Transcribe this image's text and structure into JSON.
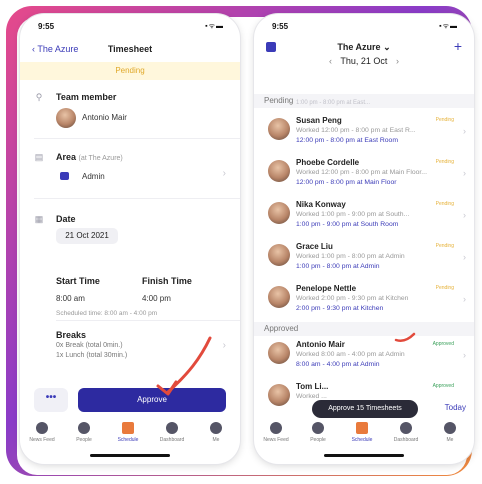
{
  "left": {
    "status_time": "9:55",
    "status_icons": "▪ᯤ▬",
    "back_label": "The Azure",
    "title": "Timesheet",
    "status_banner": "Pending",
    "team_member": {
      "label": "Team member",
      "name": "Antonio Mair"
    },
    "area": {
      "label": "Area",
      "sub": "(at The Azure)",
      "value": "Admin"
    },
    "date": {
      "label": "Date",
      "value": "21 Oct 2021"
    },
    "start": {
      "label": "Start Time",
      "value": "8:00 am"
    },
    "finish": {
      "label": "Finish Time",
      "value": "4:00 pm"
    },
    "scheduled": "Scheduled time: 8:00 am - 4:00 pm",
    "breaks": {
      "label": "Breaks",
      "line1": "0x Break (total 0min.)",
      "line2": "1x Lunch (total 30min.)"
    },
    "more_label": "•••",
    "approve_label": "Approve",
    "tabs": [
      "News Feed",
      "People",
      "Schedule",
      "Dashboard",
      "Me"
    ]
  },
  "right": {
    "status_time": "9:55",
    "status_icons": "▪ᯤ▬",
    "title": "The Azure ⌄",
    "date_nav": {
      "prev": "‹",
      "date": "Thu, 21 Oct",
      "next": "›"
    },
    "pending_header": "Pending",
    "pending_top_partial": "1:00 pm - 8:00 pm at East...",
    "approved_header": "Approved",
    "rows": [
      {
        "name": "Susan Peng",
        "worked": "Worked 12:00 pm - 8:00 pm at East R...",
        "sched": "12:00 pm - 8:00 pm at East Room",
        "badge": "Pending"
      },
      {
        "name": "Phoebe Cordelle",
        "worked": "Worked 12:00 pm - 8:00 pm at Main Floor...",
        "sched": "12:00 pm - 8:00 pm at Main Floor",
        "badge": "Pending"
      },
      {
        "name": "Nika Konway",
        "worked": "Worked 1:00 pm - 9:00 pm at South...",
        "sched": "1:00 pm - 9:00 pm at South Room",
        "badge": "Pending"
      },
      {
        "name": "Grace Liu",
        "worked": "Worked 1:00 pm - 8:00 pm at Admin",
        "sched": "1:00 pm - 8:00 pm at Admin",
        "badge": "Pending"
      },
      {
        "name": "Penelope Nettle",
        "worked": "Worked 2:00 pm - 9:30 pm at Kitchen",
        "sched": "2:00 pm - 9:30 pm at Kitchen",
        "badge": "Pending"
      },
      {
        "name": "Antonio Mair",
        "worked": "Worked 8:00 am - 4:00 pm at Admin",
        "sched": "8:00 am - 4:00 pm at Admin",
        "badge": "Approved"
      },
      {
        "name": "Tom Li...",
        "worked": "Worked ...",
        "sched": "",
        "badge": "Approved"
      }
    ],
    "toast": "Approve 15 Timesheets",
    "today": "Today",
    "tabs": [
      "News Feed",
      "People",
      "Schedule",
      "Dashboard",
      "Me"
    ]
  }
}
